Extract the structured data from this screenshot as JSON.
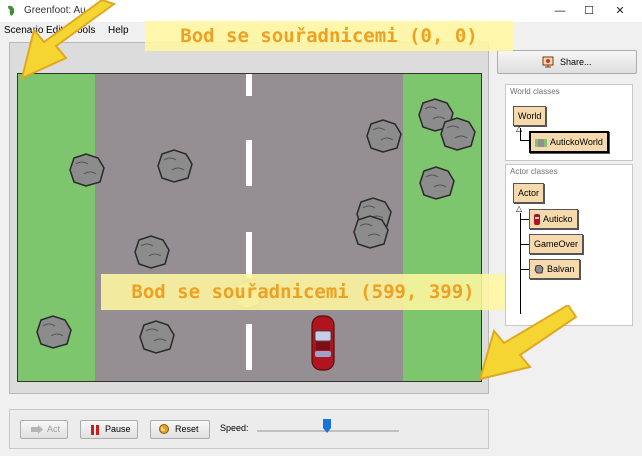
{
  "window": {
    "title": "Greenfoot: Au",
    "controls": {
      "minimize": "—",
      "maximize": "☐",
      "close": "✕"
    }
  },
  "menu": {
    "items": [
      "Scenario",
      "Edit",
      "Tools",
      "Help"
    ]
  },
  "share": {
    "label": "Share...",
    "icon": "share-icon"
  },
  "world_classes": {
    "title": "World classes",
    "items": [
      {
        "label": "World",
        "icon": ""
      },
      {
        "label": "AutickoWorld",
        "icon": "world-icon",
        "selected": true
      }
    ]
  },
  "actor_classes": {
    "title": "Actor classes",
    "items": [
      {
        "label": "Actor",
        "icon": ""
      },
      {
        "label": "Auticko",
        "icon": "car-icon"
      },
      {
        "label": "GameOver",
        "icon": ""
      },
      {
        "label": "Balvan",
        "icon": "rock-icon"
      }
    ]
  },
  "controls": {
    "act_label": "Act",
    "pause_label": "Pause",
    "reset_label": "Reset",
    "speed_label": "Speed:",
    "speed_value": 0.5
  },
  "annotations": {
    "top_label": "Bod se souřadnicemi (0, 0)",
    "bottom_label": "Bod se souřadnicemi (599, 399)"
  },
  "colors": {
    "grass": "#7dc66d",
    "road": "#958f94",
    "class_box": "#f6d9ad",
    "callout_bg": "#fff7a0",
    "callout_text": "#f0a021",
    "arrow": "#f5d532"
  }
}
